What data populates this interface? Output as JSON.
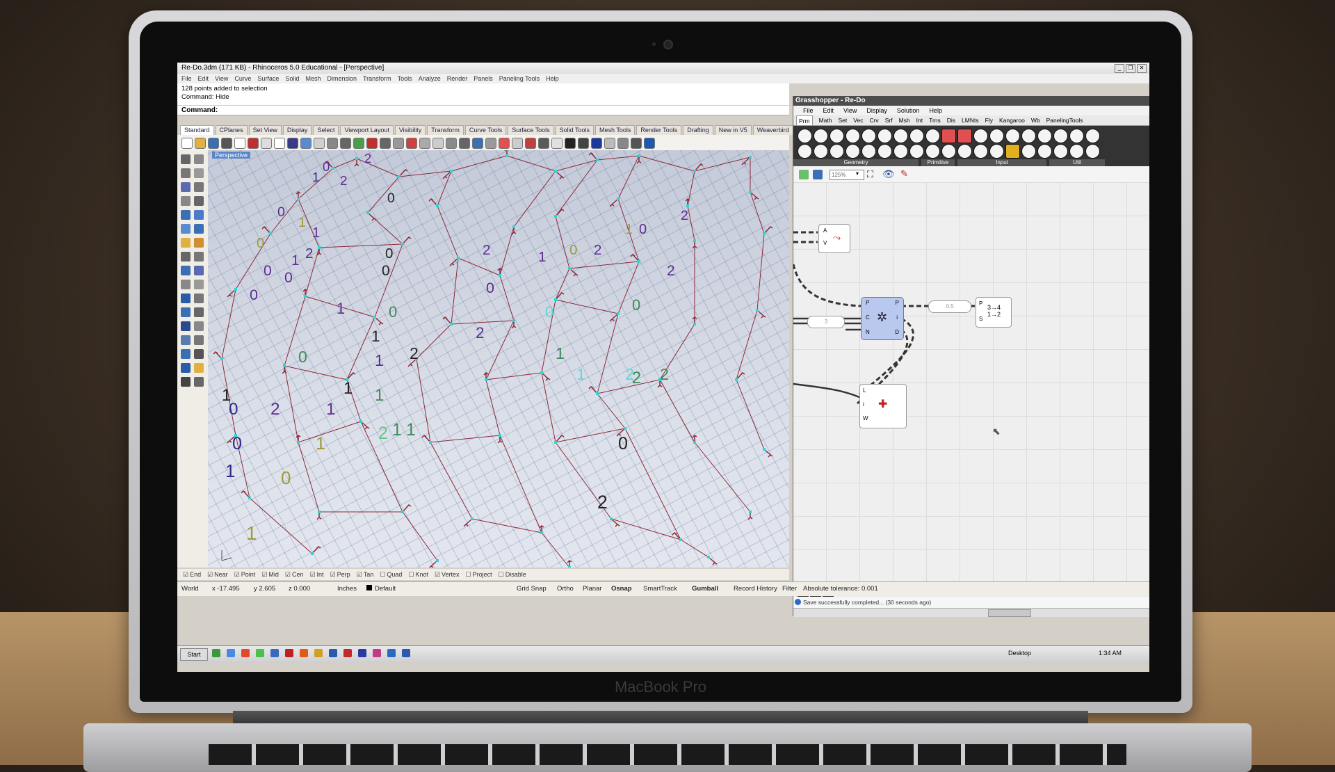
{
  "device": {
    "brand": "MacBook Pro"
  },
  "rhino": {
    "window_title": "Re-Do.3dm (171 KB) - Rhinoceros 5.0 Educational - [Perspective]",
    "menu": [
      "File",
      "Edit",
      "View",
      "Curve",
      "Surface",
      "Solid",
      "Mesh",
      "Dimension",
      "Transform",
      "Tools",
      "Analyze",
      "Render",
      "Panels",
      "Paneling Tools",
      "Help"
    ],
    "command_history": [
      "128 points added to selection",
      "Command: Hide"
    ],
    "command_prompt": "Command:",
    "toolbar_tabs": [
      "Standard",
      "CPlanes",
      "Set View",
      "Display",
      "Select",
      "Viewport Layout",
      "Visibility",
      "Transform",
      "Curve Tools",
      "Surface Tools",
      "Solid Tools",
      "Mesh Tools",
      "Render Tools",
      "Drafting",
      "New in V5",
      "Weaverbird"
    ],
    "viewport_label": "Perspective",
    "viewport_numbers": [
      {
        "t": "0",
        "c": "#5a2d91"
      },
      {
        "t": "2",
        "c": "#5a2d91"
      },
      {
        "t": "1",
        "c": "#2d2d8c"
      },
      {
        "t": "0",
        "c": "#222"
      },
      {
        "t": "2",
        "c": "#5a2d91"
      },
      {
        "t": "0",
        "c": "#5a2d91"
      },
      {
        "t": "1",
        "c": "#5a2d91"
      },
      {
        "t": "1",
        "c": "#9c9a3a"
      },
      {
        "t": "0",
        "c": "#9c9a3a"
      },
      {
        "t": "1",
        "c": "#5a2d91"
      },
      {
        "t": "0",
        "c": "#5a2d91"
      },
      {
        "t": "2",
        "c": "#5a2d91"
      },
      {
        "t": "0",
        "c": "#222"
      },
      {
        "t": "0",
        "c": "#5a2d91"
      },
      {
        "t": "0",
        "c": "#5a2d91"
      },
      {
        "t": "1",
        "c": "#5a2d91"
      },
      {
        "t": "1",
        "c": "#222"
      },
      {
        "t": "2",
        "c": "#222"
      },
      {
        "t": "0",
        "c": "#3e8a5a"
      },
      {
        "t": "0",
        "c": "#3e8a5a"
      },
      {
        "t": "1",
        "c": "#5a2d91"
      },
      {
        "t": "0",
        "c": "#62d6d6"
      },
      {
        "t": "2",
        "c": "#5a2d91"
      },
      {
        "t": "1",
        "c": "#5a2d91"
      },
      {
        "t": "2",
        "c": "#5a2d91"
      },
      {
        "t": "0",
        "c": "#5a2d91"
      },
      {
        "t": "2",
        "c": "#3e8a5a"
      },
      {
        "t": "1",
        "c": "#3e8a5a"
      },
      {
        "t": "0",
        "c": "#2d2d8c"
      },
      {
        "t": "2",
        "c": "#5a2d91"
      },
      {
        "t": "1",
        "c": "#3e8a5a"
      },
      {
        "t": "1",
        "c": "#62d6d6"
      },
      {
        "t": "2",
        "c": "#62d6d6"
      },
      {
        "t": "2",
        "c": "#3e8a5a"
      },
      {
        "t": "0",
        "c": "#3e8a5a"
      },
      {
        "t": "1",
        "c": "#3e8a5a"
      },
      {
        "t": "0",
        "c": "#222"
      },
      {
        "t": "1",
        "c": "#2d2d8c"
      },
      {
        "t": "0",
        "c": "#9c9a3a"
      },
      {
        "t": "2",
        "c": "#62c68c"
      },
      {
        "t": "2",
        "c": "#222"
      },
      {
        "t": "1",
        "c": "#5a2d91"
      },
      {
        "t": "0",
        "c": "#9c9a3a"
      },
      {
        "t": "1",
        "c": "#9c9a3a"
      },
      {
        "t": "2",
        "c": "#5a2d91"
      },
      {
        "t": "0",
        "c": "#5a2d91"
      },
      {
        "t": "1",
        "c": "#9c9a3a"
      },
      {
        "t": "2",
        "c": "#5a2d91"
      },
      {
        "t": "0",
        "c": "#222"
      },
      {
        "t": "1",
        "c": "#222"
      },
      {
        "t": "1",
        "c": "#3e8a5a"
      },
      {
        "t": "0",
        "c": "#2d2d8c"
      },
      {
        "t": "1",
        "c": "#9c9a3a"
      },
      {
        "t": "2",
        "c": "#5a2d91"
      },
      {
        "t": "1",
        "c": "#222"
      }
    ],
    "osnaps": [
      {
        "label": "End",
        "on": true
      },
      {
        "label": "Near",
        "on": true
      },
      {
        "label": "Point",
        "on": true
      },
      {
        "label": "Mid",
        "on": true
      },
      {
        "label": "Cen",
        "on": true
      },
      {
        "label": "Int",
        "on": true
      },
      {
        "label": "Perp",
        "on": true
      },
      {
        "label": "Tan",
        "on": true
      },
      {
        "label": "Quad",
        "on": false
      },
      {
        "label": "Knot",
        "on": false
      },
      {
        "label": "Vertex",
        "on": true
      },
      {
        "label": "Project",
        "on": false
      },
      {
        "label": "Disable",
        "on": false
      }
    ],
    "status": {
      "cplane": "World",
      "x": "x -17.495",
      "y": "y 2.605",
      "z": "z 0.000",
      "units": "Inches",
      "layer": "Default",
      "grid_snap": "Grid Snap",
      "ortho": "Ortho",
      "planar": "Planar",
      "osnap": "Osnap",
      "smarttrack": "SmartTrack",
      "gumball": "Gumball",
      "record_history": "Record History",
      "filter": "Filter",
      "tolerance": "Absolute tolerance: 0.001"
    }
  },
  "grasshopper": {
    "title": "Grasshopper - Re-Do",
    "menu": [
      "File",
      "Edit",
      "View",
      "Display",
      "Solution",
      "Help"
    ],
    "tabs": [
      "Prm",
      "Math",
      "Set",
      "Vec",
      "Crv",
      "Srf",
      "Msh",
      "Int",
      "Trns",
      "Dis",
      "LMNts",
      "Fly",
      "Kangaroo",
      "Wb",
      "PanelingTools"
    ],
    "ribbon_groups": [
      "Geometry",
      "Primitive",
      "Input",
      "Util"
    ],
    "zoom": "125%",
    "node_ports": {
      "n1_in": [
        "A",
        "V"
      ],
      "n2_in": [
        "P",
        "C",
        "N"
      ],
      "n2_out": [
        "P",
        "i",
        "D"
      ],
      "n3_in": [
        "P",
        "S"
      ],
      "n3_icon": "3→4\n1→2",
      "n4_in": [
        "L",
        "i",
        "W"
      ]
    },
    "panel_values": {
      "panel_a": "3",
      "panel_b": "0.5"
    },
    "status_msg": "Save successfully completed... (30 seconds ago)"
  },
  "taskbar": {
    "start": "Start",
    "desktop": "Desktop",
    "clock": "1:34 AM"
  },
  "colors": {
    "viewport_line": "#8b2a3a",
    "viewport_node": "#2ad6d6",
    "gh_node": "#b8c8ee",
    "gh_node_border": "#6677aa"
  }
}
